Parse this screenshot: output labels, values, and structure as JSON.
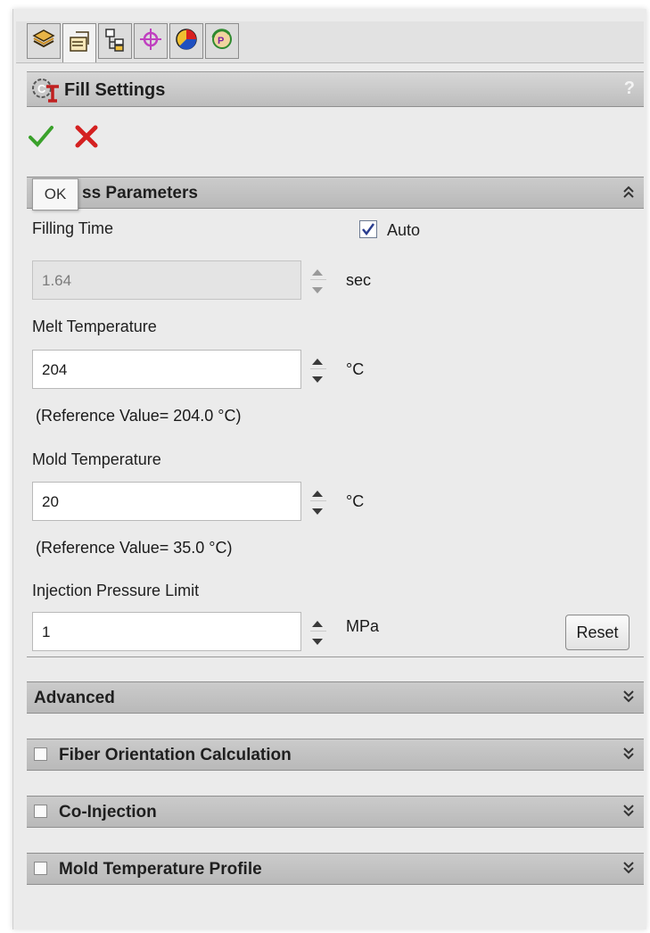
{
  "tabs": [
    {
      "icon": "feature-manager-icon"
    },
    {
      "icon": "property-manager-icon"
    },
    {
      "icon": "configuration-manager-icon"
    },
    {
      "icon": "dimxpert-icon"
    },
    {
      "icon": "display-manager-icon"
    },
    {
      "icon": "plastics-manager-icon"
    }
  ],
  "header": {
    "title": "Fill Settings",
    "help": "?"
  },
  "actions": {
    "ok_icon": "checkmark-icon",
    "cancel_icon": "cross-icon",
    "ok_tooltip": "OK"
  },
  "process": {
    "section_title": "ss Parameters",
    "filling_time_label": "Filling Time",
    "auto_label": "Auto",
    "auto_checked": true,
    "filling_time_value": "1.64",
    "filling_time_unit": "sec",
    "melt_label": "Melt Temperature",
    "melt_value": "204",
    "melt_unit": "°C",
    "melt_ref": "(Reference Value= 204.0 °C)",
    "mold_label": "Mold Temperature",
    "mold_value": "20",
    "mold_unit": "°C",
    "mold_ref": "(Reference Value= 35.0 °C)",
    "pressure_label": "Injection Pressure Limit",
    "pressure_value": "1",
    "pressure_unit": "MPa",
    "reset_label": "Reset"
  },
  "sections": [
    {
      "label": "Advanced",
      "has_checkbox": false
    },
    {
      "label": "Fiber Orientation Calculation",
      "has_checkbox": true
    },
    {
      "label": "Co-Injection",
      "has_checkbox": true
    },
    {
      "label": "Mold Temperature Profile",
      "has_checkbox": true
    }
  ],
  "colors": {
    "ok_green": "#3aa12b",
    "cancel_red": "#d42020",
    "header_gray": "#c6c6c6"
  }
}
